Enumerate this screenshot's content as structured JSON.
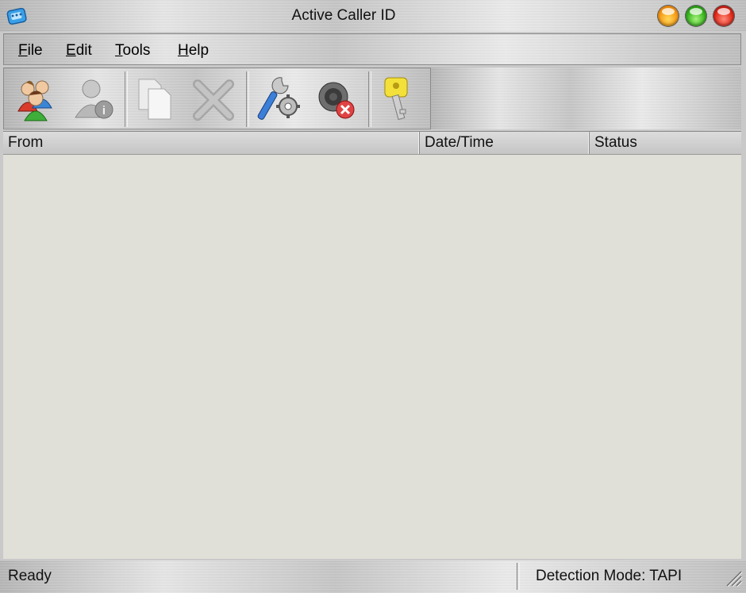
{
  "window": {
    "title": "Active Caller ID"
  },
  "menu": {
    "items": [
      {
        "first": "F",
        "rest": "ile"
      },
      {
        "first": "E",
        "rest": "dit"
      },
      {
        "first": "T",
        "rest": "ools"
      },
      {
        "first": "H",
        "rest": "elp"
      }
    ]
  },
  "toolbar": {
    "buttons": [
      "contacts-icon",
      "user-info-icon",
      "copy-icon",
      "delete-icon",
      "settings-icon",
      "mute-speaker-icon",
      "key-icon"
    ]
  },
  "list": {
    "columns": [
      "From",
      "Date/Time",
      "Status"
    ],
    "rows": []
  },
  "status_bar": {
    "status": "Ready",
    "mode": "Detection Mode: TAPI"
  },
  "colors": {
    "list_background": "#e0dfd8",
    "minimize": "#f79a14",
    "maximize": "#35b31c",
    "close": "#e02818"
  }
}
